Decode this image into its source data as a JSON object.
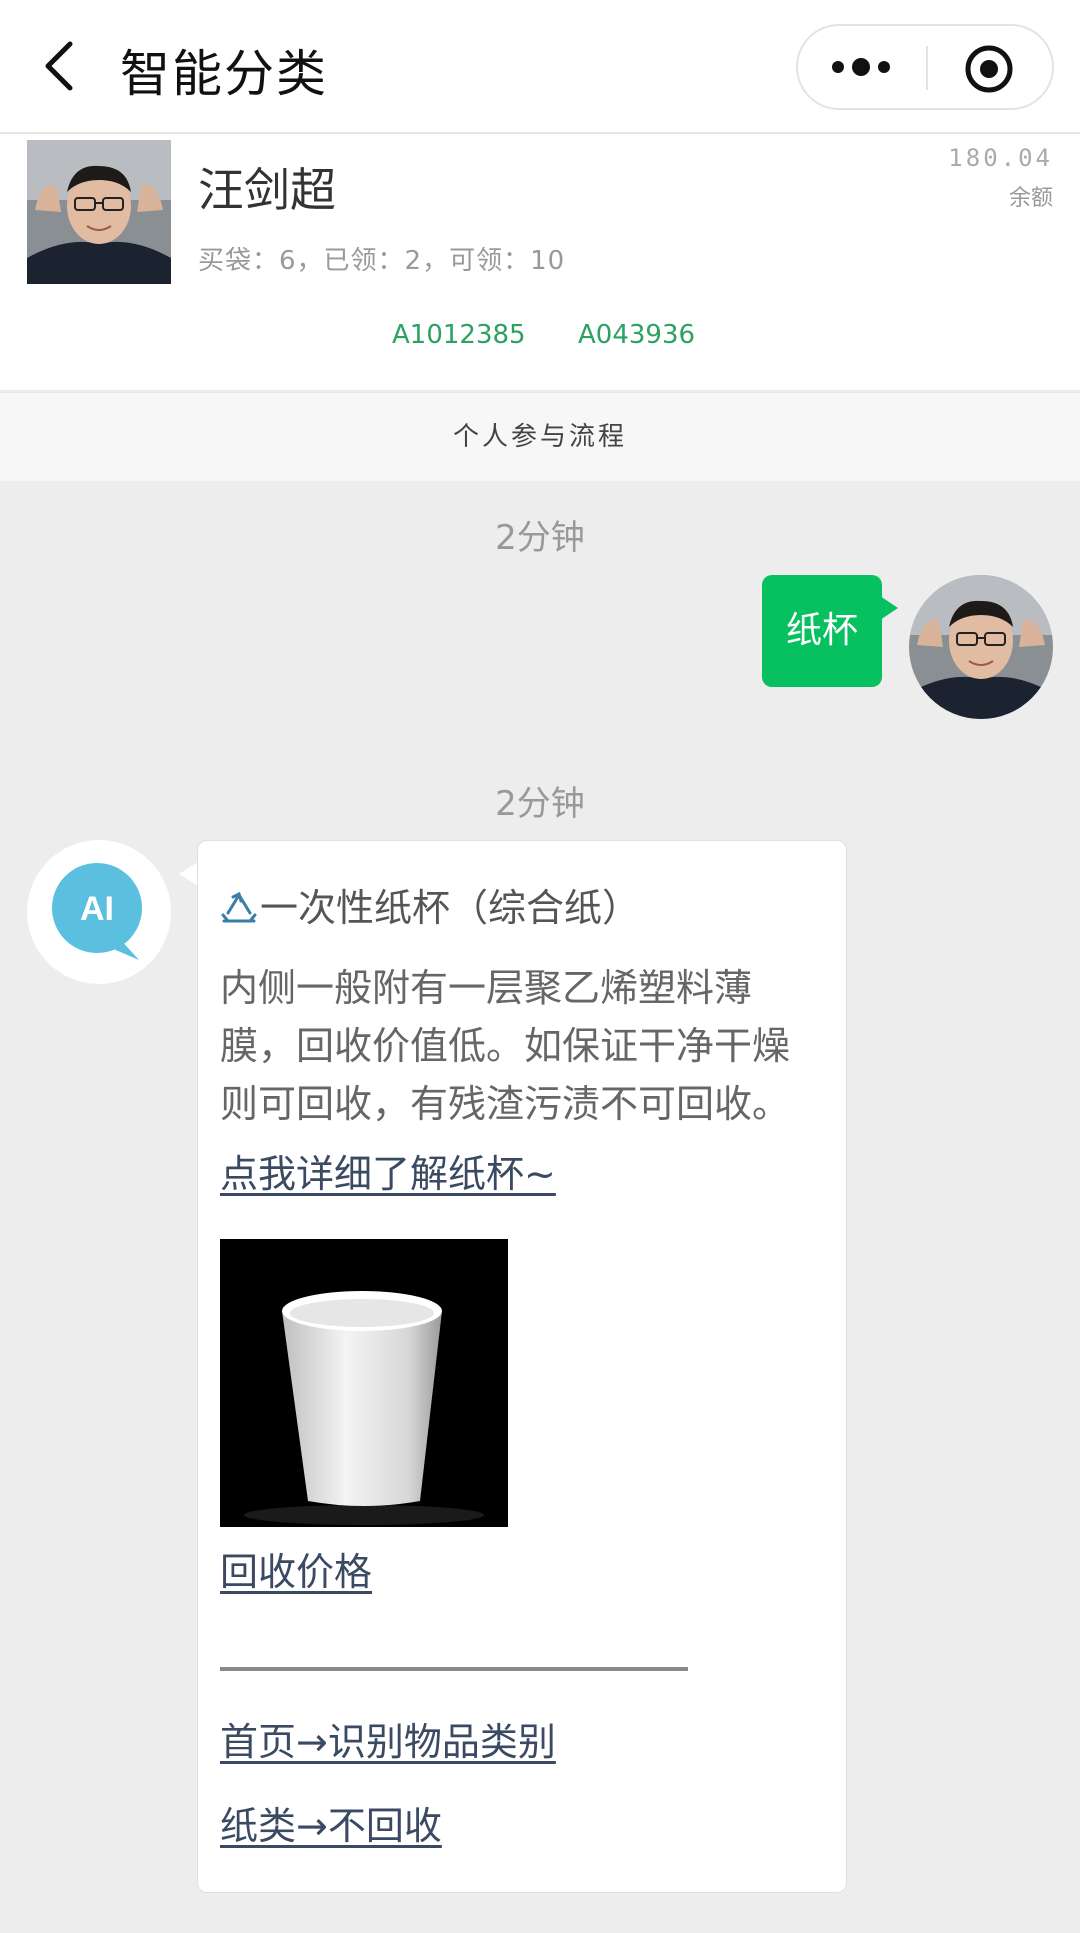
{
  "nav": {
    "title": "智能分类"
  },
  "user": {
    "name": "汪剑超",
    "stats": "买袋：6，已领：2，可领：10",
    "balance_value": "180.04",
    "balance_label": "余额",
    "codes": [
      "A1012385",
      "A043936"
    ]
  },
  "process_label": "个人参与流程",
  "chat": {
    "msg1": {
      "time": "2分钟",
      "text": "纸杯"
    },
    "msg2": {
      "time": "2分钟",
      "avatar_label": "AI",
      "title": "一次性纸杯（综合纸）",
      "description": "内侧一般附有一层聚乙烯塑料薄膜，回收价值低。如保证干净干燥则可回收，有残渣污渍不可回收。",
      "detail_link": "点我详细了解纸杯~",
      "price_link": "回收价格",
      "home_link": "首页→识别物品类别",
      "category_link": "纸类→不回收"
    }
  },
  "colors": {
    "brand_green": "#07c160",
    "code_green": "#2ca160",
    "ai_blue": "#5bbfdf",
    "link_color": "#3b4a63"
  },
  "icons": [
    "back-arrow-icon",
    "more-dots-icon",
    "target-icon",
    "recycle-icon",
    "ai-chat-icon"
  ]
}
